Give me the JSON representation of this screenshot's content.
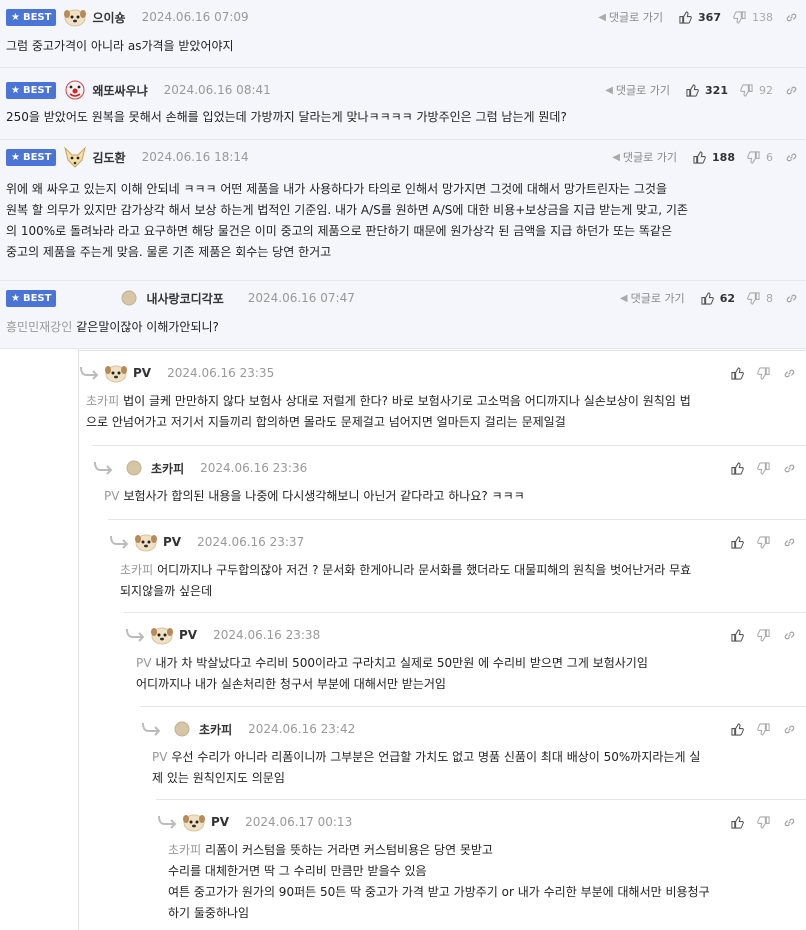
{
  "best_label": "BEST",
  "reply_link_label": "댓글로 가기",
  "best_comments": [
    {
      "author": "으이숑",
      "date": "2024.06.16 07:09",
      "up": "367",
      "down": "138",
      "mention": "",
      "lines": [
        "그럼 중고가격이 아니라 as가격을 받았어야지"
      ]
    },
    {
      "author": "왜또싸우냐",
      "date": "2024.06.16 08:41",
      "up": "321",
      "down": "92",
      "mention": "",
      "lines": [
        "250을 받았어도 원복을 못해서 손해를 입었는데 가방까지 달라는게 맞나ㅋㅋㅋㅋ 가방주인은 그럼 남는게 뭔데?"
      ]
    },
    {
      "author": "김도환",
      "date": "2024.06.16 18:14",
      "up": "188",
      "down": "6",
      "mention": "",
      "lines": [
        "위에 왜 싸우고 있는지 이해 안되네 ㅋㅋㅋ 어떤 제품을 내가 사용하다가 타의로 인해서 망가지면 그것에 대해서 망가트린자는 그것을",
        "원복 할 의무가 있지만 감가상각 해서 보상 하는게 법적인 기준임. 내가 A/S를 원하면 A/S에 대한 비용+보상금을 지급 받는게 맞고, 기존",
        "의 100%로 돌려놔라 라고 요구하면 해당 물건은 이미 중고의 제품으로 판단하기 때문에 원가상각 된 금액을 지급 하던가 또는 똑같은",
        "중고의 제품을 주는게 맞음. 물론 기존 제품은 회수는 당연 한거고"
      ]
    },
    {
      "author": "내사랑코디각포",
      "date": "2024.06.16 07:47",
      "up": "62",
      "down": "8",
      "mention": "흥민민재강인",
      "lines": [
        "같은말이잖아 이해가안되니?"
      ]
    }
  ],
  "replies": [
    {
      "author": "PV",
      "date": "2024.06.16 23:35",
      "mention": "초카피",
      "lines": [
        "법이 글케 만만하지 않다 보험사 상대로 저럴게 한다? 바로 보험사기로 고소먹음 어디까지나 실손보상이 원칙임 법",
        "으로 안넘어가고 저기서 지들끼리 합의하면 몰라도 문제걸고 넘어지면 얼마든지 걸리는 문제일걸"
      ]
    },
    {
      "author": "초카피",
      "date": "2024.06.16 23:36",
      "mention": "PV",
      "lines": [
        "보험사가 합의된 내용을 나중에 다시생각해보니 아닌거 같다라고 하나요? ㅋㅋㅋ"
      ]
    },
    {
      "author": "PV",
      "date": "2024.06.16 23:37",
      "mention": "초카피",
      "lines": [
        "어디까지나 구두합의잖아 저건 ? 문서화 한게아니라 문서화를 했더라도 대물피해의 원칙을 벗어난거라 무효",
        "되지않을까 싶은데"
      ]
    },
    {
      "author": "PV",
      "date": "2024.06.16 23:38",
      "mention": "PV",
      "lines": [
        "내가 차 박살났다고 수리비 500이라고 구라치고 실제로 50만원 에 수리비 받으면 그게 보험사기임",
        "어디까지나 내가 실손처리한 청구서 부분에 대해서만 받는거임"
      ]
    },
    {
      "author": "초카피",
      "date": "2024.06.16 23:42",
      "mention": "PV",
      "lines": [
        "우선 수리가 아니라 리폼이니까 그부분은 언급할 가치도 없고 명품 신품이 최대 배상이 50%까지라는게 실",
        "제 있는 원칙인지도 의문임"
      ]
    },
    {
      "author": "PV",
      "date": "2024.06.17 00:13",
      "mention": "초카피",
      "lines": [
        "리폼이 커스텀을 뜻하는 거라면 커스텀비용은 당연 못받고",
        "수리를 대체한거면 딱 그 수리비 만큼만 받을수 있음",
        "여튼 중고가가 원가의 90퍼든 50든 딱 중고가 가격 받고 가방주기 or 내가 수리한 부분에 대해서만 비용청구",
        "하기 둘중하나임"
      ]
    }
  ]
}
